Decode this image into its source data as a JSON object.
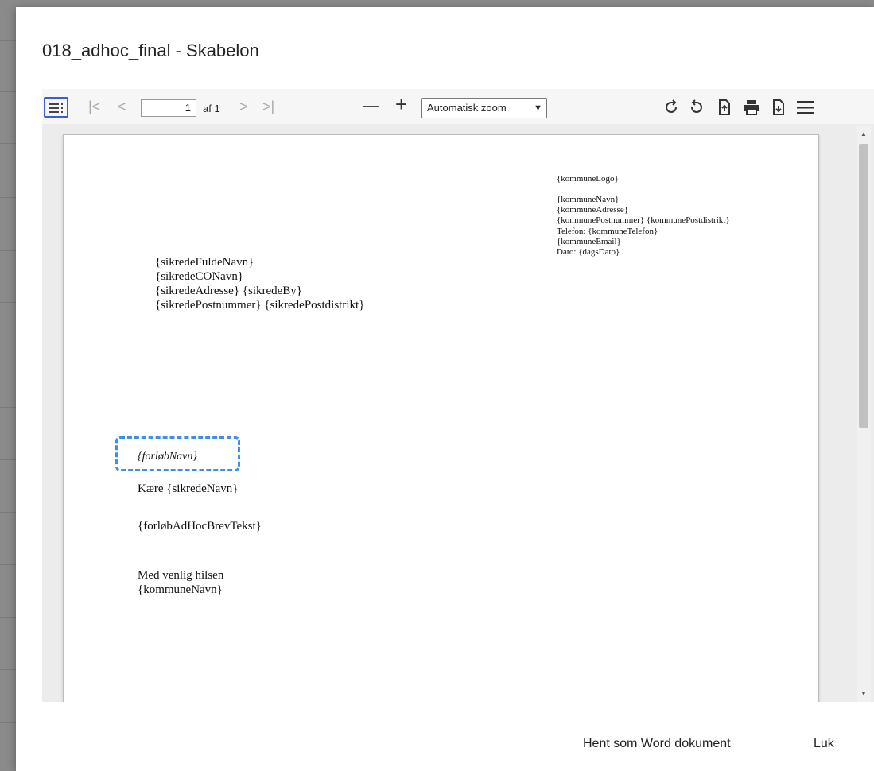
{
  "dialog": {
    "title": "018_adhoc_final - Skabelon"
  },
  "toolbar": {
    "sidebar_icon": "sidebar-toggle-icon",
    "first_page_glyph": "|<",
    "prev_page_glyph": "<",
    "page_number": "1",
    "page_of": "af 1",
    "next_page_glyph": ">",
    "last_page_glyph": ">|",
    "zoom_out_glyph": "—",
    "zoom_in_glyph": "+",
    "zoom_value": "Automatisk zoom",
    "icons": [
      "rotate-clockwise-icon",
      "rotate-counterclockwise-icon",
      "open-file-icon",
      "print-icon",
      "download-icon",
      "tools-menu-icon"
    ]
  },
  "document": {
    "header_right": {
      "logo": "{kommuneLogo}",
      "lines": [
        "{kommuneNavn}",
        "{kommuneAdresse}",
        "{kommunePostnummer} {kommunePostdistrikt}",
        "Telefon: {kommuneTelefon}",
        "{kommuneEmail}",
        "Dato: {dagsDato}"
      ]
    },
    "recipient": [
      "{sikredeFuldeNavn}",
      "{sikredeCONavn}",
      "{sikredeAdresse} {sikredeBy}",
      "{sikredePostnummer} {sikredePostdistrikt}"
    ],
    "subject": "{forløbNavn}",
    "greeting": "Kære {sikredeNavn}",
    "body": "{forløbAdHocBrevTekst}",
    "closing": "Med venlig hilsen",
    "signature": "{kommuneNavn}"
  },
  "footer": {
    "download_word_label": "Hent som Word dokument",
    "close_label": "Luk"
  },
  "colors": {
    "highlight": "#3d8ef0",
    "active_toolbar_border": "#3b5bdb"
  }
}
